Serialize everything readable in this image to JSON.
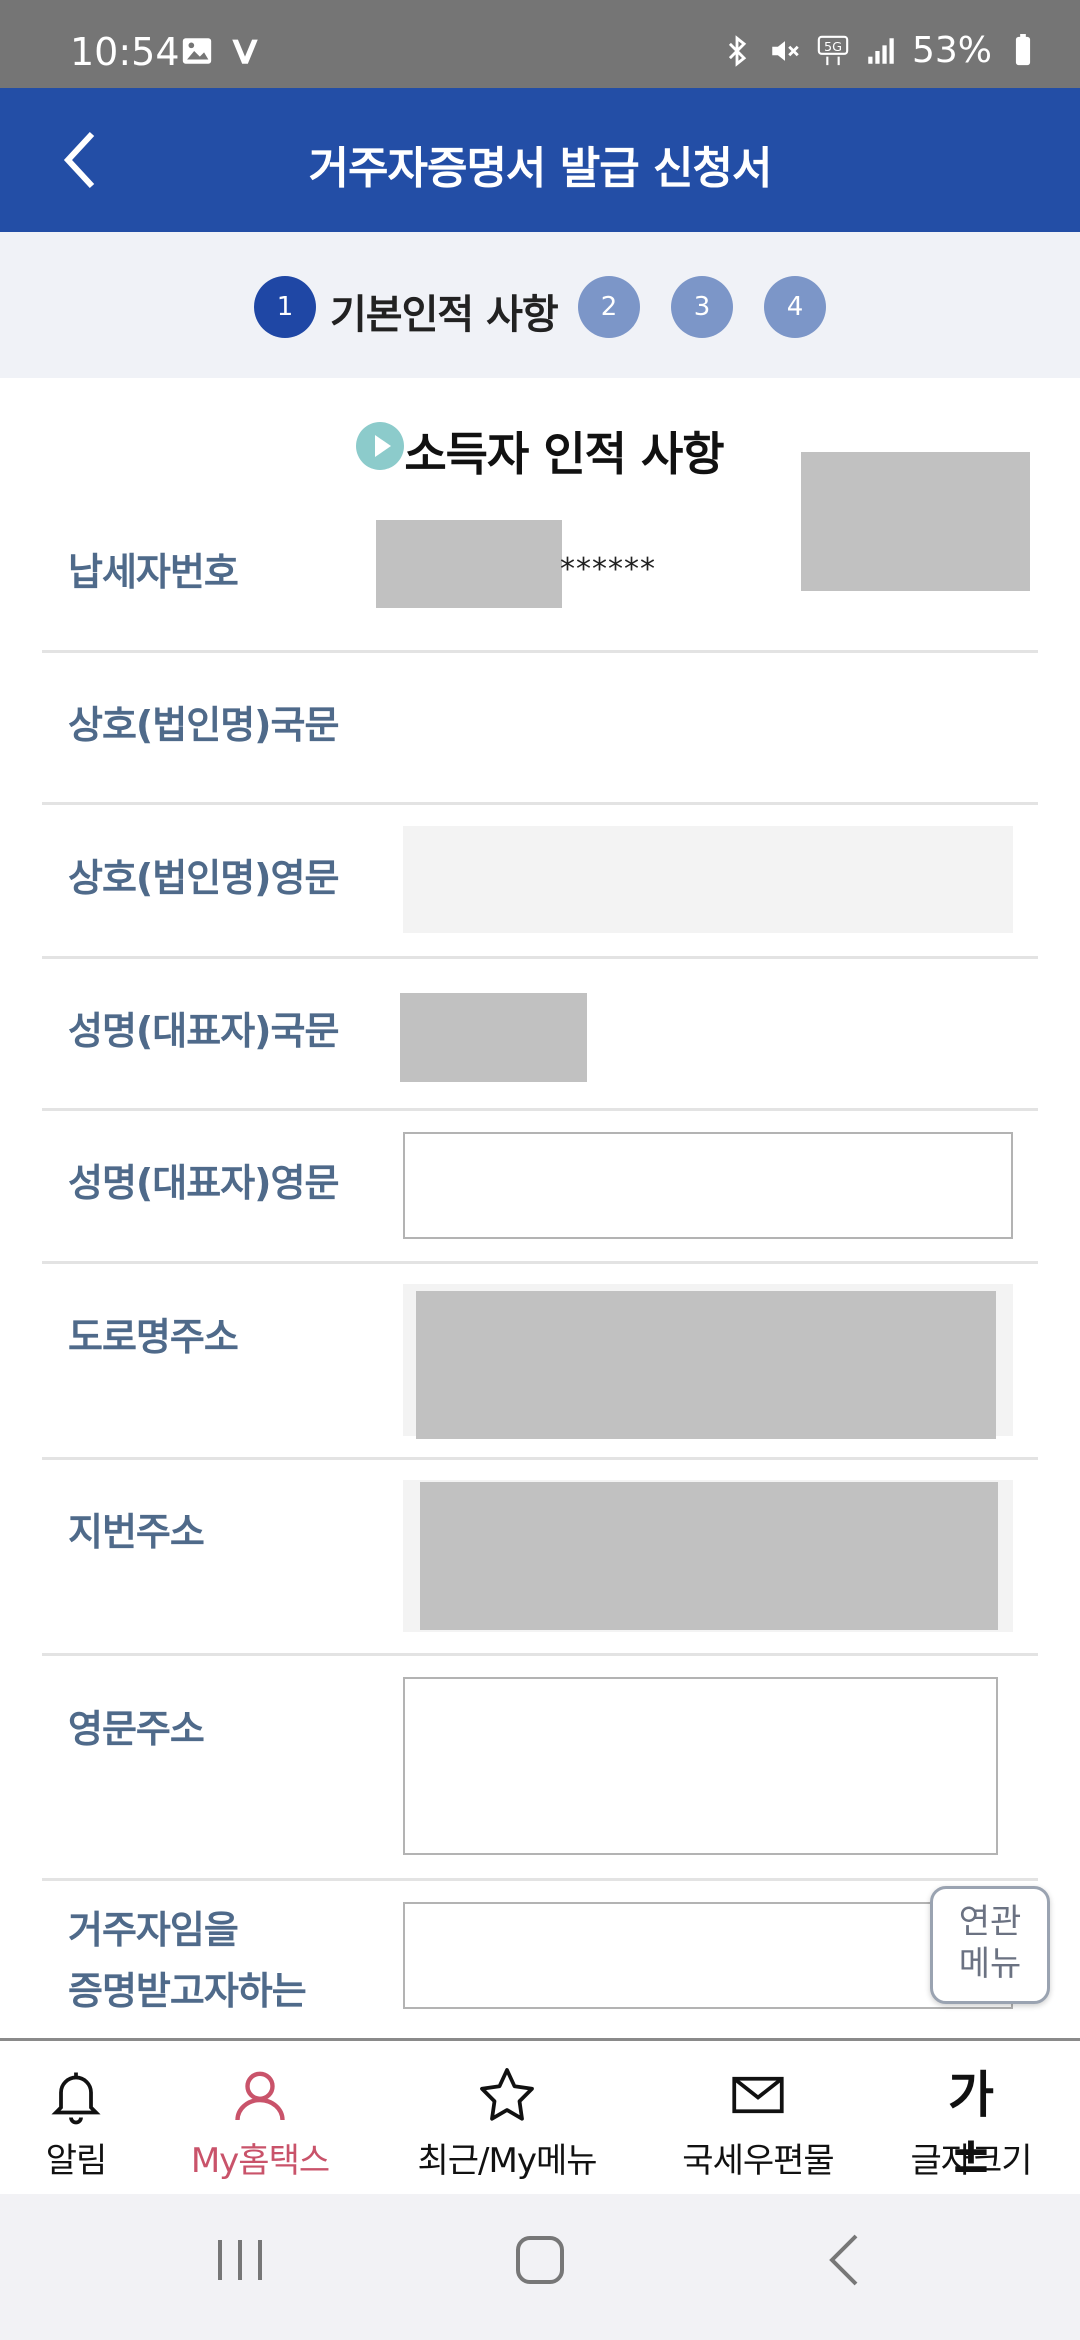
{
  "status_bar": {
    "time": "10:54",
    "battery": "53%",
    "left_icons": [
      "gallery-icon",
      "v-app-icon"
    ],
    "right_icons": [
      "bluetooth-icon",
      "mute-icon",
      "5g-icon",
      "signal-icon",
      "battery-icon"
    ]
  },
  "header": {
    "title": "거주자증명서 발급 신청서",
    "background": "#234ea6"
  },
  "steps": {
    "items": [
      {
        "number": "1",
        "active": true
      },
      {
        "number": "2",
        "active": false
      },
      {
        "number": "3",
        "active": false
      },
      {
        "number": "4",
        "active": false
      }
    ],
    "current_label": "기본인적 사항"
  },
  "section": {
    "title": "소득자 인적 사항"
  },
  "form": {
    "taxpayer_number": {
      "label": "납세자번호",
      "masked_suffix": "******"
    },
    "company_kr": {
      "label": "상호(법인명)국문",
      "value": ""
    },
    "company_en": {
      "label": "상호(법인명)영문",
      "value": ""
    },
    "name_kr": {
      "label": "성명(대표자)국문"
    },
    "name_en": {
      "label": "성명(대표자)영문",
      "value": ""
    },
    "road_address": {
      "label": "도로명주소"
    },
    "lot_address": {
      "label": "지번주소"
    },
    "english_address": {
      "label": "영문주소",
      "value": ""
    },
    "purpose": {
      "label_line1": "거주자임을",
      "label_line2": "증명받고자하는",
      "value": ""
    }
  },
  "related_menu": {
    "line1": "연관",
    "line2": "메뉴"
  },
  "bottom_nav": [
    {
      "label": "알림",
      "icon": "bell-icon",
      "active": false
    },
    {
      "label": "My홈택스",
      "icon": "person-icon",
      "active": true
    },
    {
      "label": "최근/My메뉴",
      "icon": "star-icon",
      "active": false
    },
    {
      "label": "국세우편물",
      "icon": "mail-icon",
      "active": false
    },
    {
      "label": "글자크기",
      "icon": "font-size-icon",
      "icon_text": "가±",
      "active": false
    }
  ],
  "colors": {
    "accent": "#234ea6",
    "step_active": "#1f47a5",
    "step_inactive": "#7c96c8",
    "label": "#4f6a8a",
    "nav_active": "#c9536a"
  }
}
